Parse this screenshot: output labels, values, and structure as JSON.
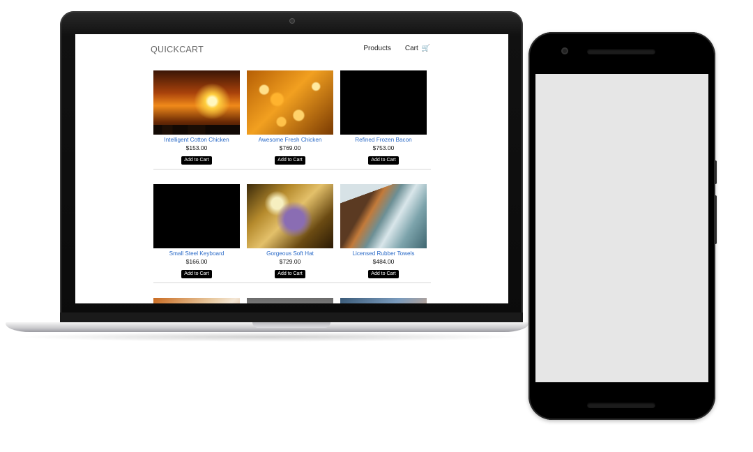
{
  "site": {
    "brand": "QUICKCART",
    "nav": {
      "products": "Products",
      "cart": "Cart"
    }
  },
  "icons": {
    "cart": "shopping-cart-icon"
  },
  "products": [
    {
      "name": "Intelligent Cotton Chicken",
      "price": "$153.00",
      "button": "Add to Cart",
      "image": "soccer-sunset"
    },
    {
      "name": "Awesome Fresh Chicken",
      "price": "$769.00",
      "button": "Add to Cart",
      "image": "golden-bokeh"
    },
    {
      "name": "Refined Frozen Bacon",
      "price": "$753.00",
      "button": "Add to Cart",
      "image": "black"
    },
    {
      "name": "Small Steel Keyboard",
      "price": "$166.00",
      "button": "Add to Cart",
      "image": "black"
    },
    {
      "name": "Gorgeous Soft Hat",
      "price": "$729.00",
      "button": "Add to Cart",
      "image": "glass-reflection"
    },
    {
      "name": "Licensed Rubber Towels",
      "price": "$484.00",
      "button": "Add to Cart",
      "image": "rocky-coast"
    }
  ],
  "colors": {
    "link": "#2a6ac7",
    "button_bg": "#000000",
    "button_text": "#ffffff",
    "brand_text": "#666666",
    "phone_screen": "#e6e6e6"
  }
}
